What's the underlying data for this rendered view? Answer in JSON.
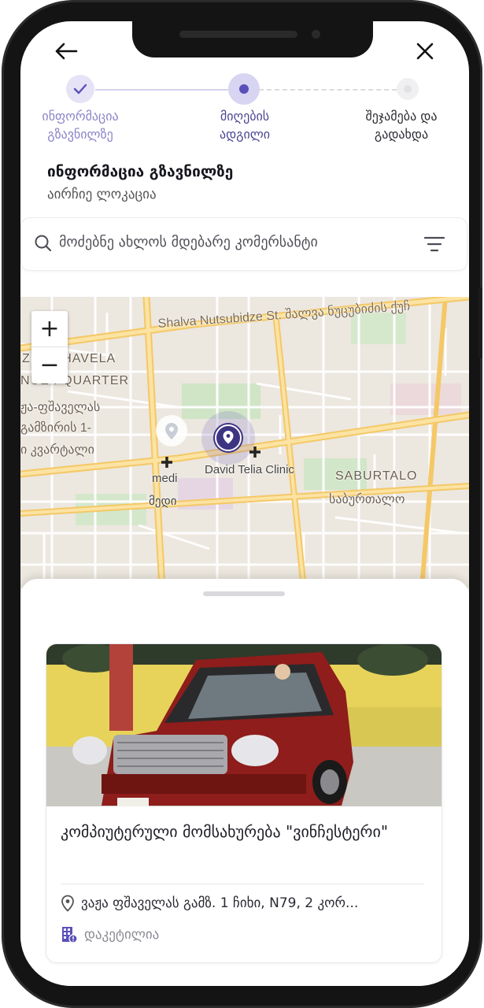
{
  "header": {
    "back_icon": "arrow-left-icon",
    "close_icon": "close-icon"
  },
  "stepper": {
    "steps": [
      {
        "label": "ინფორმაცია\nგზავნილზე",
        "state": "done"
      },
      {
        "label": "მიღების\nადგილი",
        "state": "active"
      },
      {
        "label": "შეჯამება და\nგადახდა",
        "state": "pending"
      }
    ]
  },
  "section": {
    "title": "ინფორმაცია გზავნილზე",
    "subtitle": "აირჩიე ლოკაცია"
  },
  "search": {
    "placeholder": "მოძებნე ახლოს მდებარე კომერსანტი"
  },
  "map": {
    "zoom_in": "+",
    "zoom_out": "−",
    "labels": {
      "street": "Shalva Nutsubidze St. შალვა ნუცუბიძის ქუჩ",
      "district_en_1": "ZHA SHAVELA",
      "district_en_2": "NUE I QUARTER",
      "district_ka_1": "ჟა-ფშაველას",
      "district_ka_2": "გამზირის 1-",
      "district_ka_3": "ი კვარტალი",
      "medi_en": "medi",
      "medi_ka": "მედი",
      "clinic": "David Telia Clinic",
      "saburtalo_en": "SABURTALO",
      "saburtalo_ka": "საბურთალო"
    }
  },
  "card": {
    "title": "კომპიუტერული მომსახურება \"ვინჩესტერი\"",
    "address": "ვაჟა ფშაველას გამზ. 1 ჩიხი, N79, 2 კორ...",
    "category": "დაკეტილია",
    "address_icon": "location-pin-icon",
    "category_icon": "building-icon"
  },
  "colors": {
    "accent": "#4b4591",
    "accent_light": "#d8d5f3",
    "map_background": "#ece7df",
    "major_road": "#f8d47a"
  }
}
